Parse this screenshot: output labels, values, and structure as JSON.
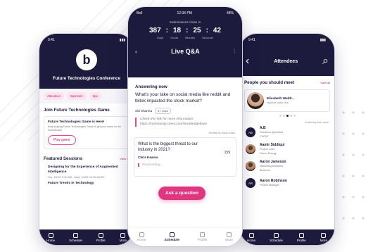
{
  "left_phone": {
    "status_time": "9:41",
    "conference_title": "Future Technologies Conference",
    "logo_letter": "b",
    "chips": [
      "Attendees",
      "Sponsors",
      "Spe"
    ],
    "game_section_title": "Join Future Technologies Game",
    "game_card_title": "Future Technologies Game is Here!",
    "game_card_desc": "Keep playing Future Technologies Game to get your name on the leaderboard!",
    "play_button": "Play game",
    "featured_title": "Featured Sessions",
    "featured_view_all": "View all",
    "sessions": [
      {
        "title": "Designing for the Experience of Augmented Intelligence",
        "when": "Tue, 10/20, 9:30 AM - Wed, 10/28, 10:30 AM ET"
      },
      {
        "title": "Future Trends in Technology",
        "when": ""
      }
    ],
    "tabs": [
      "Home",
      "Schedule",
      "Profile",
      "More"
    ]
  },
  "center_phone": {
    "status_left": "Bell",
    "status_time": "12:34 PM",
    "status_right": "48%",
    "timer_label": "Submissions close in",
    "timer_values": [
      "387",
      "18",
      "25",
      "42"
    ],
    "timer_units": [
      "Days",
      "Hours",
      "Minutes",
      "Seconds"
    ],
    "title": "Live Q&A",
    "answering_label": "Answering now",
    "question": "What's your take on social media like reddit and tiktok impacted the stock market?",
    "asker": "Sid Sharma",
    "votes": "57 votes",
    "reply": "Check this link for more information: https://community.cvent.com/knowledgebase",
    "sort_label": "Sorted by most votes",
    "question2": "What is the biggest threat to our industry in 2021?",
    "question2_votes": "159",
    "question2_by": "Chris Kearns",
    "responding_label": "Responding...",
    "ask_button": "Ask a question",
    "tabs": [
      "Home",
      "Schedule",
      "Profile",
      "More"
    ]
  },
  "right_phone": {
    "status_time": "9:41",
    "title": "Attendees",
    "section_title": "People you should meet",
    "view_all": "View all",
    "suggestion_name": "Elisabeth Waldr...",
    "suggestion_role": "regional sales dire...",
    "sort_label": "Sorted by first name",
    "attendees": [
      {
        "initials": "AB",
        "name": "A.B",
        "role": "Solutions Specialist",
        "company": "CVENT"
      },
      {
        "initials": "",
        "name": "Aamir Siddiqui",
        "role": "Project Lead",
        "company": "Green Energy"
      },
      {
        "initials": "",
        "name": "Aaron Jameson",
        "role": "Marketing Assistant",
        "company": "Bluecore"
      },
      {
        "initials": "AR",
        "name": "Aaron Robinson",
        "role": "Project Manager",
        "company": ""
      }
    ],
    "tabs": [
      "Home",
      "Schedule",
      "Profile",
      "More"
    ]
  },
  "colors": {
    "navy": "#1c1a3d",
    "accent": "#e0357f"
  }
}
